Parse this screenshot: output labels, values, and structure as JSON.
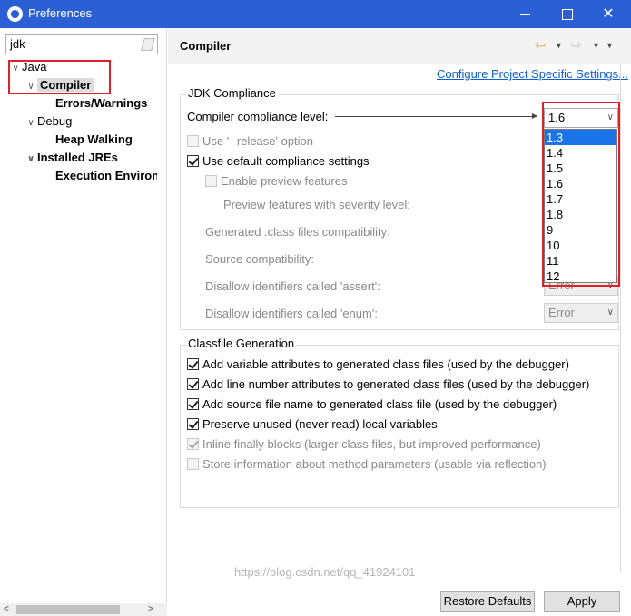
{
  "window": {
    "title": "Preferences"
  },
  "filter": {
    "value": "jdk"
  },
  "tree": {
    "items": [
      {
        "label": "Java",
        "twist": "∨"
      },
      {
        "label": "Compiler",
        "twist": "∨"
      },
      {
        "label": "Errors/Warnings",
        "twist": ""
      },
      {
        "label": "Debug",
        "twist": "∨"
      },
      {
        "label": "Heap Walking",
        "twist": ""
      },
      {
        "label": "Installed JREs",
        "twist": "∨"
      },
      {
        "label": "Execution Environ",
        "twist": ""
      }
    ]
  },
  "page": {
    "title": "Compiler",
    "configure_link": "Configure Project Specific Settings..."
  },
  "jdk": {
    "group_title": "JDK Compliance",
    "compliance_label": "Compiler compliance level:",
    "compliance_value": "1.6",
    "release_option": "Use '--release' option",
    "use_default": "Use default compliance settings",
    "enable_preview": "Enable preview features",
    "preview_severity": "Preview features with severity level:",
    "generated_compat": "Generated .class files compatibility:",
    "source_compat": "Source compatibility:",
    "disallow_assert": "Disallow identifiers called 'assert':",
    "disallow_enum": "Disallow identifiers called 'enum':",
    "assert_value": "Error",
    "enum_value": "Error",
    "options": [
      "1.3",
      "1.4",
      "1.5",
      "1.6",
      "1.7",
      "1.8",
      "9",
      "10",
      "11",
      "12"
    ]
  },
  "classfile": {
    "group_title": "Classfile Generation",
    "items": [
      "Add variable attributes to generated class files (used by the debugger)",
      "Add line number attributes to generated class files (used by the debugger)",
      "Add source file name to generated class file (used by the debugger)",
      "Preserve unused (never read) local variables",
      "Inline finally blocks (larger class files, but improved performance)",
      "Store information about method parameters (usable via reflection)"
    ]
  },
  "buttons": {
    "restore": "Restore Defaults",
    "apply": "Apply"
  },
  "watermark": "https://blog.csdn.net/qq_41924101",
  "colors": {
    "titlebar": "#2b5fd4",
    "highlight": "#e0202a",
    "link": "#0b5fd0",
    "selection": "#1a73e8"
  }
}
